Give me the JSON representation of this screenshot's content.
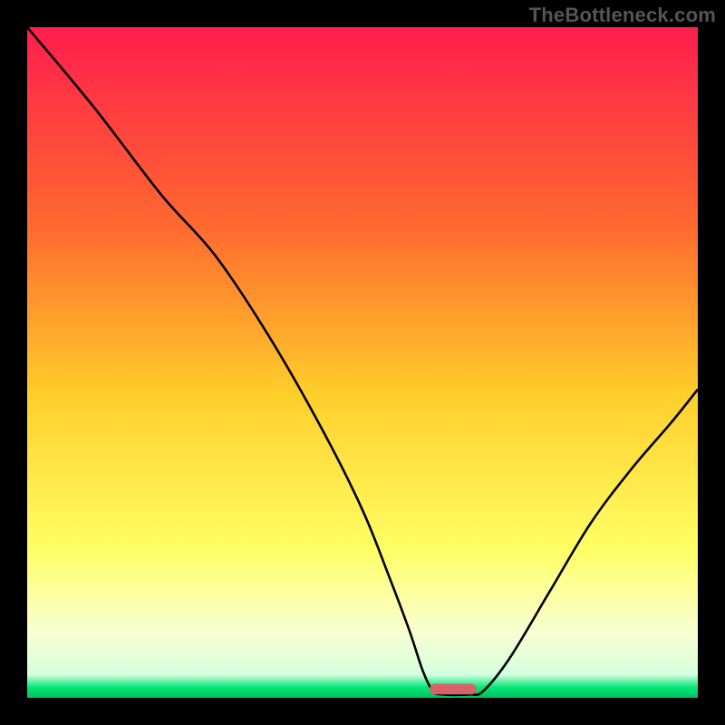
{
  "watermark": "TheBottleneck.com",
  "colors": {
    "frame": "#000000",
    "watermark": "#555555",
    "gradient_top": "#ff1d4d",
    "gradient_mid_upper": "#ff8a2a",
    "gradient_mid": "#ffd92a",
    "gradient_mid_lower": "#ffff66",
    "gradient_low": "#f9ffd0",
    "gradient_green": "#00e676",
    "curve": "#000000",
    "marker": "#d9616a"
  },
  "chart_data": {
    "type": "line",
    "title": "",
    "xlabel": "",
    "ylabel": "",
    "xlim": [
      0,
      100
    ],
    "ylim": [
      0,
      100
    ],
    "series": [
      {
        "name": "bottleneck-curve",
        "x": [
          0,
          10,
          20,
          28,
          36,
          44,
          50,
          54,
          57,
          59,
          60.5,
          62,
          66,
          68,
          72,
          78,
          84,
          90,
          96,
          100
        ],
        "y": [
          100,
          88,
          75,
          66,
          54,
          40,
          28,
          18,
          10,
          4,
          1,
          0.5,
          0.5,
          1,
          6,
          16,
          26,
          34,
          41,
          46
        ]
      }
    ],
    "marker": {
      "name": "optimal-range",
      "x_start": 60,
      "x_end": 67,
      "y": 0.5,
      "height": 1.6
    },
    "gradient_stops": [
      {
        "offset": 0.0,
        "color": "#ff1d4d"
      },
      {
        "offset": 0.3,
        "color": "#ff6a2f"
      },
      {
        "offset": 0.55,
        "color": "#ffcf2a"
      },
      {
        "offset": 0.78,
        "color": "#ffff66"
      },
      {
        "offset": 0.9,
        "color": "#f9ffd0"
      },
      {
        "offset": 0.965,
        "color": "#d6ffe0"
      },
      {
        "offset": 0.985,
        "color": "#00e676"
      },
      {
        "offset": 1.0,
        "color": "#00c060"
      }
    ]
  }
}
